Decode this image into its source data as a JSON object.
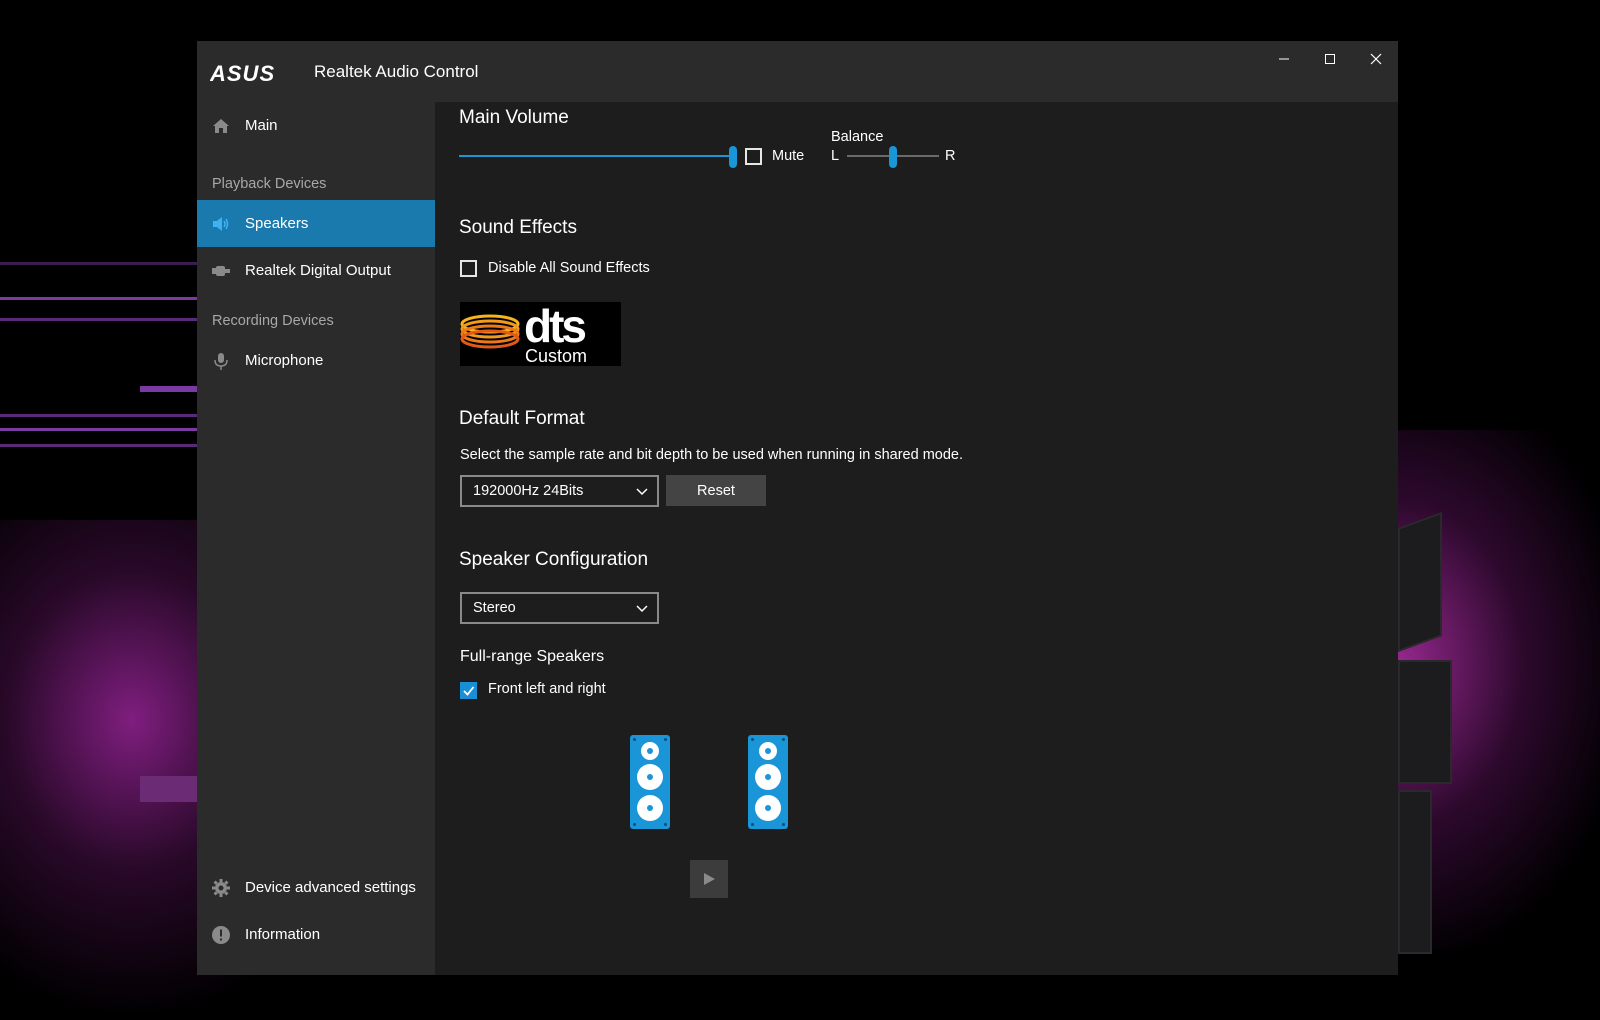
{
  "window": {
    "brand": "ASUS",
    "title": "Realtek Audio Control",
    "controls": {
      "minimize_icon": "minimize-icon",
      "maximize_icon": "maximize-icon",
      "close_icon": "close-icon"
    }
  },
  "sidebar": {
    "main": {
      "label": "Main",
      "icon": "home-icon"
    },
    "playback_label": "Playback Devices",
    "playback": [
      {
        "label": "Speakers",
        "icon": "speaker-icon",
        "active": true
      },
      {
        "label": "Realtek Digital Output",
        "icon": "digital-output-icon",
        "active": false
      }
    ],
    "recording_label": "Recording Devices",
    "recording": [
      {
        "label": "Microphone",
        "icon": "microphone-icon"
      }
    ],
    "bottom": [
      {
        "label": "Device advanced settings",
        "icon": "gear-icon"
      },
      {
        "label": "Information",
        "icon": "info-icon"
      }
    ]
  },
  "main_volume": {
    "heading": "Main Volume",
    "level": 1.0,
    "mute_label": "Mute",
    "mute_checked": false,
    "balance_label": "Balance",
    "balance_left": "L",
    "balance_right": "R",
    "balance_value": 0.5
  },
  "sound_effects": {
    "heading": "Sound Effects",
    "disable_label": "Disable All Sound Effects",
    "disable_checked": false,
    "dts_logo_text": "dts",
    "dts_sub": "Custom"
  },
  "default_format": {
    "heading": "Default Format",
    "description": "Select the sample rate and bit depth to be used when running in shared mode.",
    "selected": "192000Hz 24Bits",
    "reset_label": "Reset"
  },
  "speaker_config": {
    "heading": "Speaker Configuration",
    "selected": "Stereo",
    "full_range_heading": "Full-range Speakers",
    "front_lr_label": "Front left and right",
    "front_lr_checked": true,
    "play_icon": "play-icon"
  },
  "colors": {
    "accent": "#1a7aad",
    "speaker_blue": "#1a95d8",
    "window_bg": "#1d1d1d",
    "sidebar_bg": "#2b2b2b"
  }
}
